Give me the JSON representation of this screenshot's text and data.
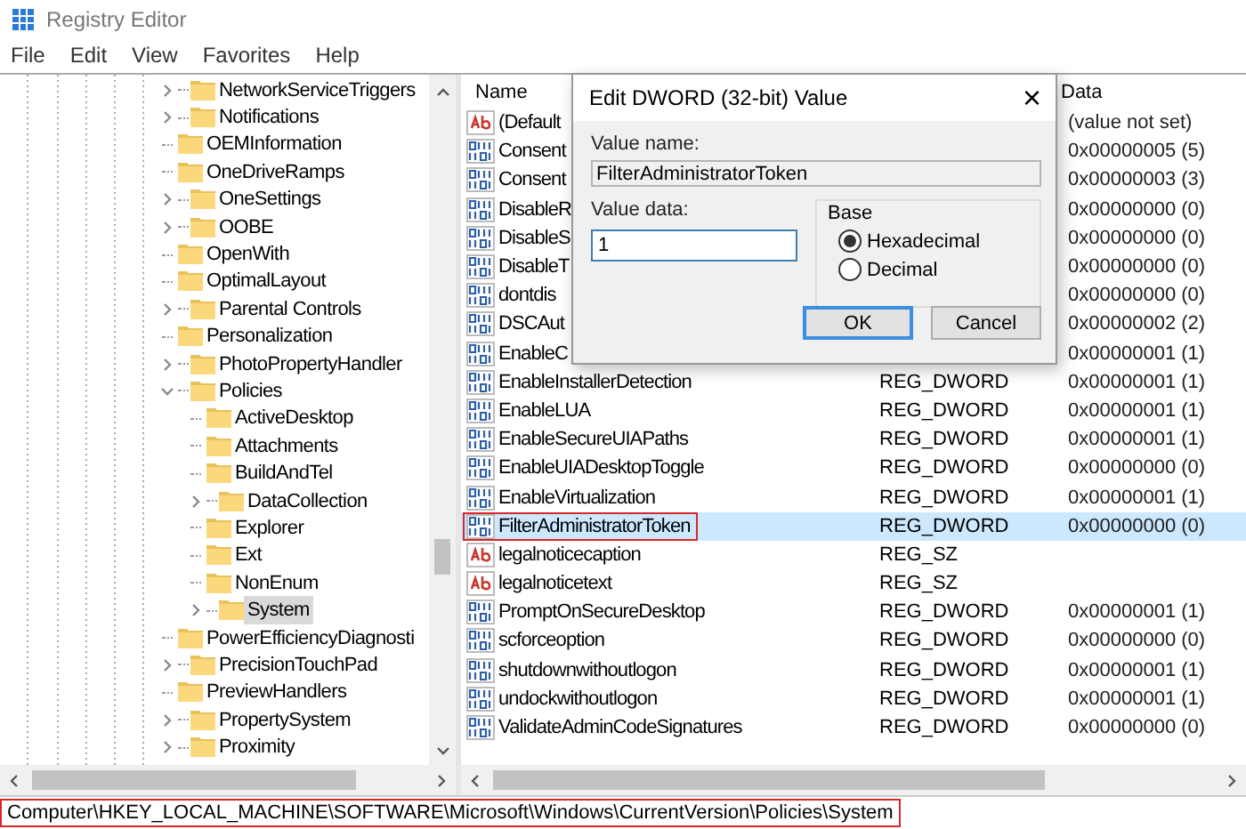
{
  "window": {
    "title": "Registry Editor"
  },
  "menu": [
    "File",
    "Edit",
    "View",
    "Favorites",
    "Help"
  ],
  "tree": [
    {
      "label": "NetworkServiceTriggers",
      "has_children": true,
      "expanded": false,
      "selected": false
    },
    {
      "label": "Notifications",
      "has_children": true,
      "expanded": false,
      "selected": false
    },
    {
      "label": "OEMInformation",
      "has_children": false,
      "selected": false
    },
    {
      "label": "OneDriveRamps",
      "has_children": false,
      "selected": false
    },
    {
      "label": "OneSettings",
      "has_children": true,
      "expanded": false,
      "selected": false
    },
    {
      "label": "OOBE",
      "has_children": true,
      "expanded": false,
      "selected": false
    },
    {
      "label": "OpenWith",
      "has_children": false,
      "selected": false
    },
    {
      "label": "OptimalLayout",
      "has_children": false,
      "selected": false
    },
    {
      "label": "Parental Controls",
      "has_children": true,
      "expanded": false,
      "selected": false
    },
    {
      "label": "Personalization",
      "has_children": false,
      "selected": false
    },
    {
      "label": "PhotoPropertyHandler",
      "has_children": true,
      "expanded": false,
      "selected": false
    },
    {
      "label": "Policies",
      "has_children": true,
      "expanded": true,
      "selected": false,
      "children": [
        {
          "label": "ActiveDesktop",
          "has_children": false,
          "selected": false
        },
        {
          "label": "Attachments",
          "has_children": false,
          "selected": false
        },
        {
          "label": "BuildAndTel",
          "has_children": false,
          "selected": false
        },
        {
          "label": "DataCollection",
          "has_children": true,
          "expanded": false,
          "selected": false
        },
        {
          "label": "Explorer",
          "has_children": false,
          "selected": false
        },
        {
          "label": "Ext",
          "has_children": false,
          "selected": false
        },
        {
          "label": "NonEnum",
          "has_children": false,
          "selected": false
        },
        {
          "label": "System",
          "has_children": true,
          "expanded": false,
          "selected": true
        }
      ]
    },
    {
      "label": "PowerEfficiencyDiagnosti",
      "has_children": false,
      "selected": false
    },
    {
      "label": "PrecisionTouchPad",
      "has_children": true,
      "expanded": false,
      "selected": false
    },
    {
      "label": "PreviewHandlers",
      "has_children": false,
      "selected": false
    },
    {
      "label": "PropertySystem",
      "has_children": true,
      "expanded": false,
      "selected": false
    },
    {
      "label": "Proximity",
      "has_children": true,
      "expanded": false,
      "selected": false
    }
  ],
  "list": {
    "columns": [
      "Name",
      "Data"
    ],
    "rows": [
      {
        "kind": "string",
        "name": "(Default",
        "data": "(value not set)",
        "selected": false,
        "outlined": false
      },
      {
        "kind": "dword",
        "name": "Consent",
        "data": "0x00000005 (5)",
        "selected": false,
        "outlined": false
      },
      {
        "kind": "dword",
        "name": "Consent",
        "data": "0x00000003 (3)",
        "selected": false,
        "outlined": false
      },
      {
        "kind": "dword",
        "name": "DisableR",
        "data": "0x00000000 (0)",
        "selected": false,
        "outlined": false
      },
      {
        "kind": "dword",
        "name": "DisableS",
        "data": "0x00000000 (0)",
        "selected": false,
        "outlined": false
      },
      {
        "kind": "dword",
        "name": "DisableT",
        "data": "0x00000000 (0)",
        "selected": false,
        "outlined": false
      },
      {
        "kind": "dword",
        "name": "dontdis",
        "data": "0x00000000 (0)",
        "selected": false,
        "outlined": false
      },
      {
        "kind": "dword",
        "name": "DSCAut",
        "data": "0x00000002 (2)",
        "selected": false,
        "outlined": false
      },
      {
        "kind": "dword",
        "name": "EnableC",
        "data": "0x00000001 (1)",
        "selected": false,
        "outlined": false
      },
      {
        "kind": "dword",
        "name": "EnableInstallerDetection",
        "type": "REG_DWORD",
        "data": "0x00000001 (1)",
        "selected": false,
        "outlined": false
      },
      {
        "kind": "dword",
        "name": "EnableLUA",
        "type": "REG_DWORD",
        "data": "0x00000001 (1)",
        "selected": false,
        "outlined": false
      },
      {
        "kind": "dword",
        "name": "EnableSecureUIAPaths",
        "type": "REG_DWORD",
        "data": "0x00000001 (1)",
        "selected": false,
        "outlined": false
      },
      {
        "kind": "dword",
        "name": "EnableUIADesktopToggle",
        "type": "REG_DWORD",
        "data": "0x00000000 (0)",
        "selected": false,
        "outlined": false
      },
      {
        "kind": "dword",
        "name": "EnableVirtualization",
        "type": "REG_DWORD",
        "data": "0x00000001 (1)",
        "selected": false,
        "outlined": false
      },
      {
        "kind": "dword",
        "name": "FilterAdministratorToken",
        "type": "REG_DWORD",
        "data": "0x00000000 (0)",
        "selected": true,
        "outlined": true
      },
      {
        "kind": "string",
        "name": "legalnoticecaption",
        "type": "REG_SZ",
        "selected": false,
        "outlined": false
      },
      {
        "kind": "string",
        "name": "legalnoticetext",
        "type": "REG_SZ",
        "selected": false,
        "outlined": false
      },
      {
        "kind": "dword",
        "name": "PromptOnSecureDesktop",
        "type": "REG_DWORD",
        "data": "0x00000001 (1)",
        "selected": false,
        "outlined": false
      },
      {
        "kind": "dword",
        "name": "scforceoption",
        "type": "REG_DWORD",
        "data": "0x00000000 (0)",
        "selected": false,
        "outlined": false
      },
      {
        "kind": "dword",
        "name": "shutdownwithoutlogon",
        "type": "REG_DWORD",
        "data": "0x00000001 (1)",
        "selected": false,
        "outlined": false
      },
      {
        "kind": "dword",
        "name": "undockwithoutlogon",
        "type": "REG_DWORD",
        "data": "0x00000001 (1)",
        "selected": false,
        "outlined": false
      },
      {
        "kind": "dword",
        "name": "ValidateAdminCodeSignatures",
        "type": "REG_DWORD",
        "data": "0x00000000 (0)",
        "selected": false,
        "outlined": false
      }
    ]
  },
  "dialog": {
    "title": "Edit DWORD (32-bit) Value",
    "close": "×",
    "value_name_label": "Value name:",
    "value_name": "FilterAdministratorToken",
    "value_data_label": "Value data:",
    "value_data": "1",
    "base_label": "Base",
    "base_options": [
      {
        "label": "Hexadecimal",
        "selected": true
      },
      {
        "label": "Decimal",
        "selected": false
      }
    ],
    "buttons": [
      {
        "label": "OK",
        "default": true
      },
      {
        "label": "Cancel",
        "default": false
      }
    ]
  },
  "status_bar": {
    "path": "Computer\\HKEY_LOCAL_MACHINE\\SOFTWARE\\Microsoft\\Windows\\CurrentVersion\\Policies\\System",
    "outlined": true
  }
}
